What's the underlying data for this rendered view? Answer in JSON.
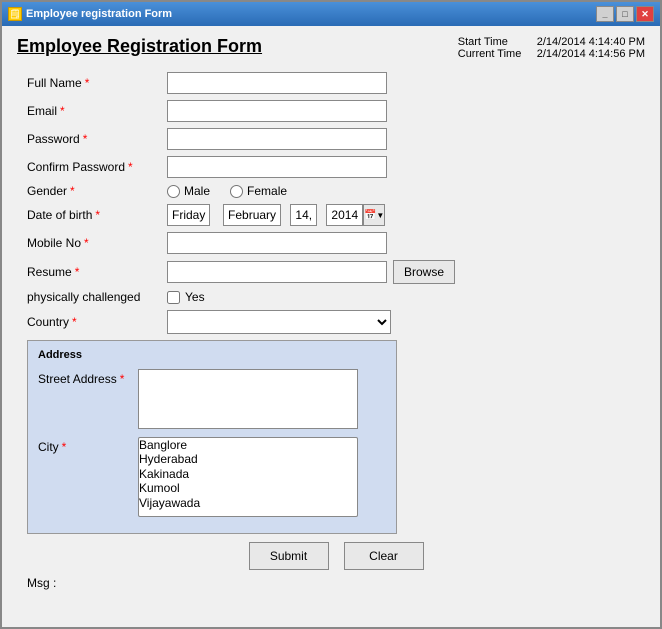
{
  "window": {
    "title": "Employee registration Form",
    "icon": "🗒",
    "title_buttons": [
      "_",
      "□",
      "✕"
    ]
  },
  "header": {
    "form_title": "Employee Registration Form",
    "start_time_label": "Start Time",
    "start_time_value": "2/14/2014 4:14:40 PM",
    "current_time_label": "Current Time",
    "current_time_value": "2/14/2014 4:14:56 PM"
  },
  "form": {
    "full_name_label": "Full Name",
    "email_label": "Email",
    "password_label": "Password",
    "confirm_password_label": "Confirm Password",
    "gender_label": "Gender",
    "gender_male": "Male",
    "gender_female": "Female",
    "dob_label": "Date of birth",
    "dob_day": "Friday",
    "dob_sep1": ",",
    "dob_month": "February",
    "dob_date": "14,",
    "dob_year": "2014",
    "mobile_label": "Mobile No",
    "resume_label": "Resume",
    "browse_label": "Browse",
    "phys_challenge_label": "physically challenged",
    "phys_challenge_yes": "Yes",
    "country_label": "Country",
    "address_legend": "Address",
    "street_label": "Street Address",
    "city_label": "City",
    "city_options": [
      "Banglore",
      "Hyderabad",
      "Kakinada",
      "Kumool",
      "Vijayawada"
    ],
    "submit_label": "Submit",
    "clear_label": "Clear",
    "msg_label": "Msg :"
  },
  "required_mark": "*"
}
